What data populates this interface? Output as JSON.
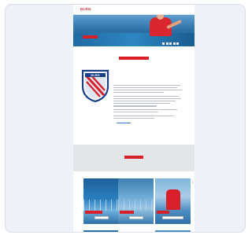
{
  "header": {
    "logo_text": "DLRG",
    "nav_text": "",
    "brand_color": "#d91f2a"
  },
  "hero": {
    "headline": "",
    "image": "swimmer-in-pool"
  },
  "intro": {
    "title": "",
    "cta_label": ""
  },
  "club": {
    "crest_icon": "dlrg-shield-crest",
    "name": "",
    "subtitle": "",
    "link_text": ""
  },
  "band": {
    "title": "",
    "cta_label": ""
  },
  "tiles": [
    {
      "image": "pool-lanes",
      "label": "",
      "button": ""
    },
    {
      "image": "pool-water",
      "label": "",
      "button": ""
    },
    {
      "image": "lifeguard",
      "label": "",
      "button": ""
    }
  ],
  "colors": {
    "title_blue": "#1a4f9c",
    "band_gray": "#e3e5e8",
    "frame_bg": "#eef1f8"
  }
}
